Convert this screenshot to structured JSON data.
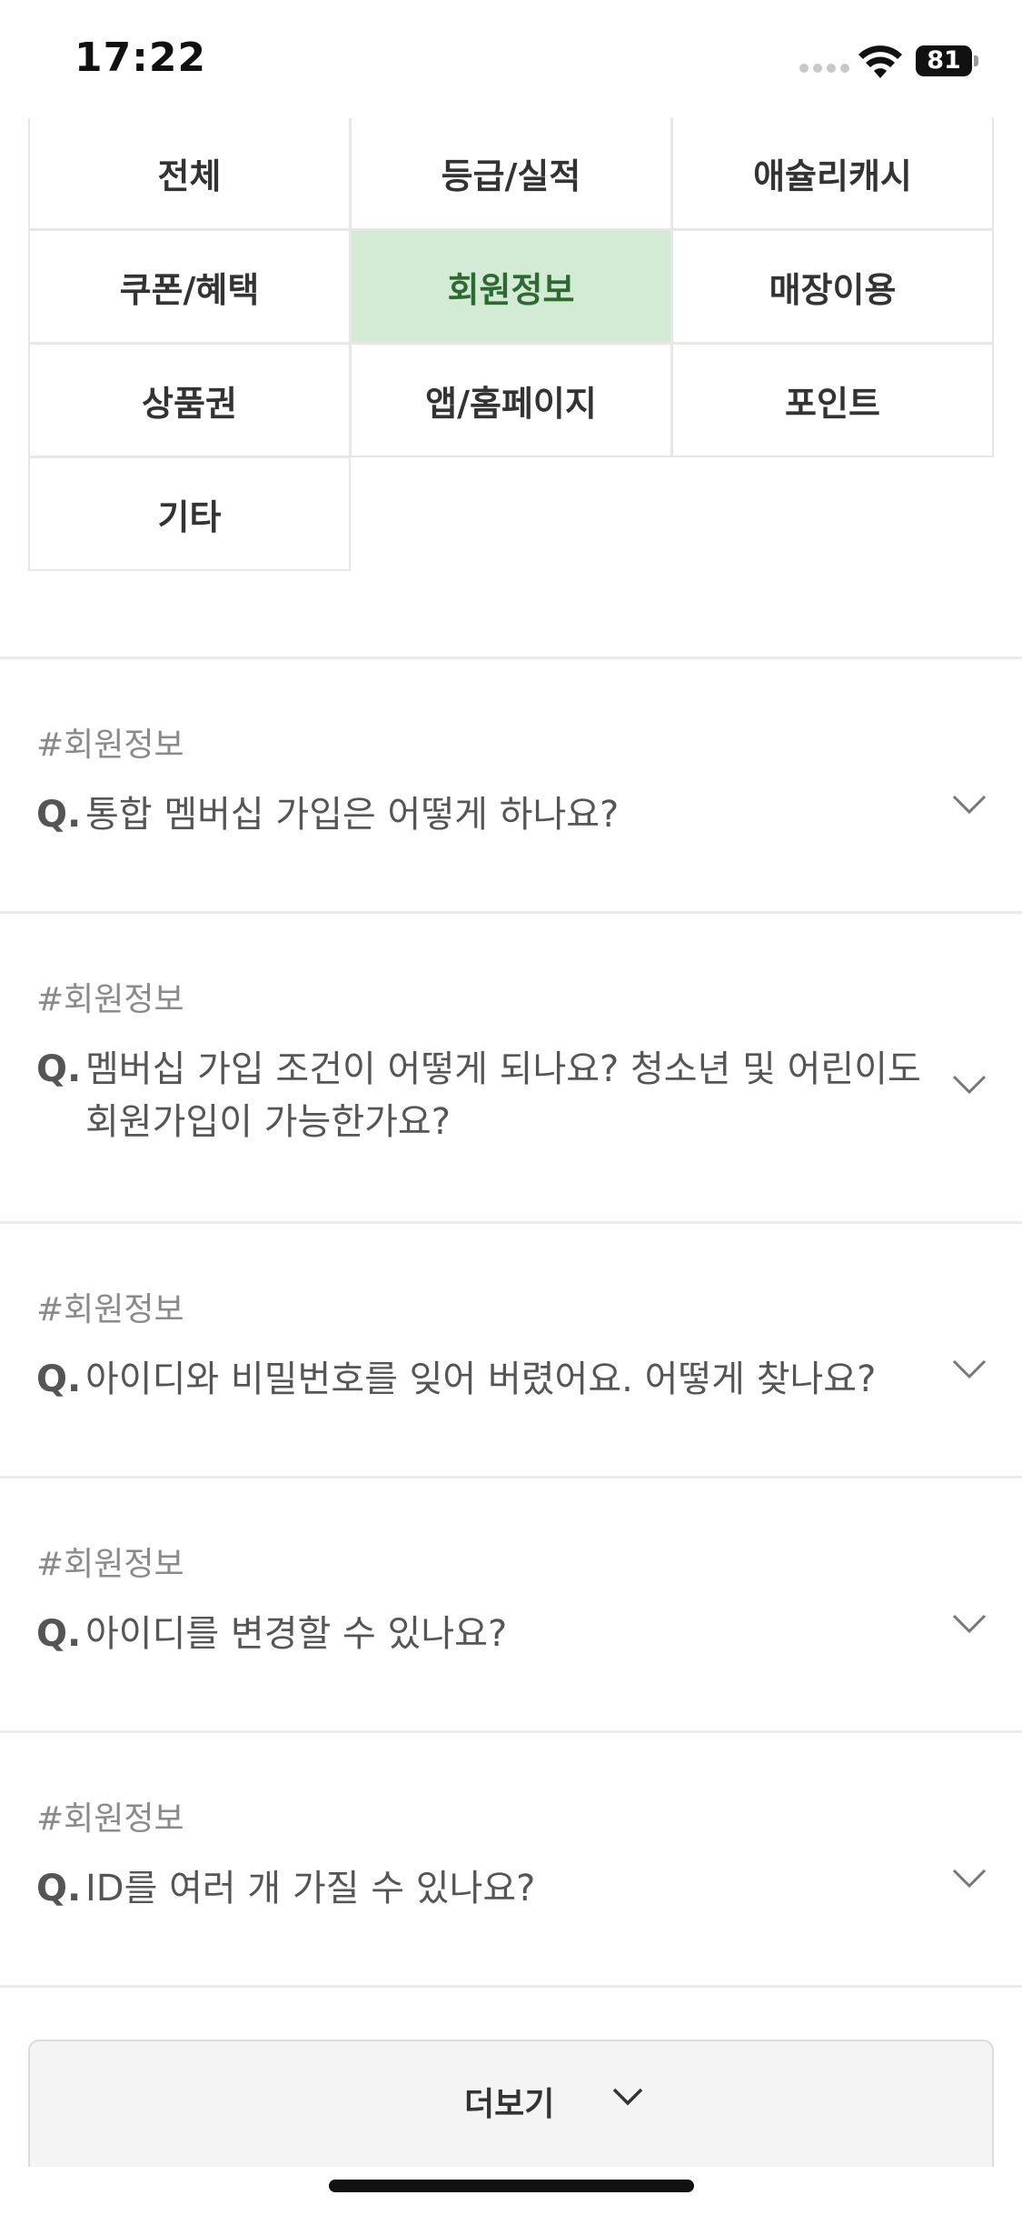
{
  "status_bar": {
    "time": "17:22",
    "battery": "81"
  },
  "categories": [
    {
      "label": "전체",
      "active": false
    },
    {
      "label": "등급/실적",
      "active": false
    },
    {
      "label": "애슐리캐시",
      "active": false
    },
    {
      "label": "쿠폰/혜택",
      "active": false
    },
    {
      "label": "회원정보",
      "active": true
    },
    {
      "label": "매장이용",
      "active": false
    },
    {
      "label": "상품권",
      "active": false
    },
    {
      "label": "앱/홈페이지",
      "active": false
    },
    {
      "label": "포인트",
      "active": false
    },
    {
      "label": "기타",
      "active": false
    }
  ],
  "faq": [
    {
      "tag": "#회원정보",
      "q": "Q.",
      "question": "통합 멤버십 가입은 어떻게 하나요?"
    },
    {
      "tag": "#회원정보",
      "q": "Q.",
      "question": "멤버십 가입 조건이 어떻게 되나요? 청소년 및 어린이도 회원가입이 가능한가요?"
    },
    {
      "tag": "#회원정보",
      "q": "Q.",
      "question": "아이디와 비밀번호를 잊어 버렸어요. 어떻게 찾나요?"
    },
    {
      "tag": "#회원정보",
      "q": "Q.",
      "question": "아이디를 변경할 수 있나요?"
    },
    {
      "tag": "#회원정보",
      "q": "Q.",
      "question": "ID를 여러 개 가질 수 있나요?"
    }
  ],
  "more_button": {
    "label": "더보기"
  },
  "icons": {
    "expand": "chevron-down-icon",
    "wifi": "wifi-icon",
    "battery": "battery-icon",
    "signal": "cellular-signal-icon"
  },
  "colors": {
    "active_bg": "#d3ead5",
    "active_text": "#2d6a31",
    "tag_text": "#8a8a8a"
  }
}
